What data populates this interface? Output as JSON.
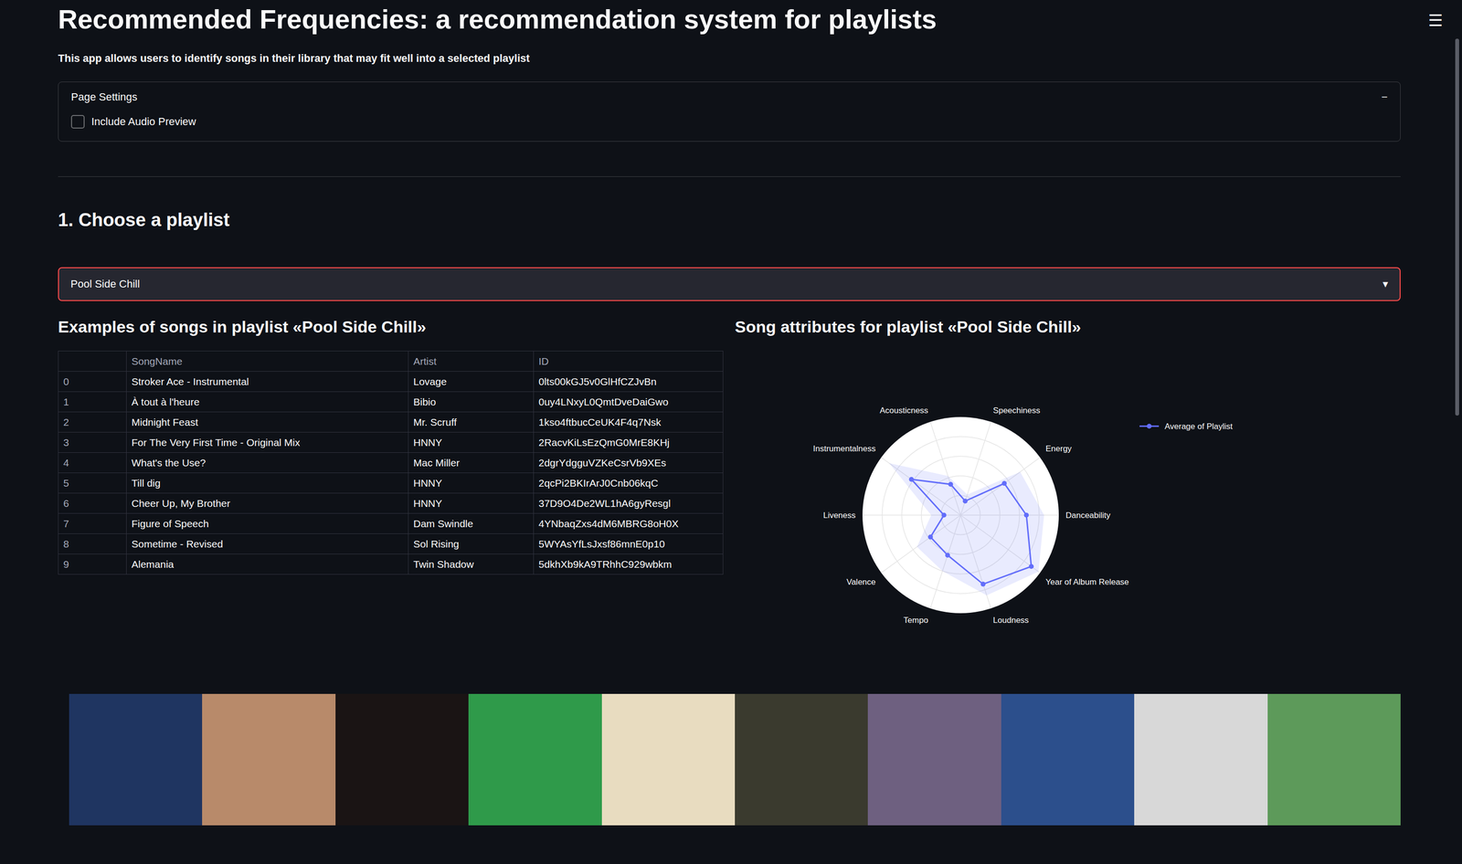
{
  "app": {
    "title": "Recommended Frequencies: a recommendation system for playlists",
    "subtitle": "This app allows users to identify songs in their library that may fit well into a selected playlist",
    "menu_icon": "☰"
  },
  "settings": {
    "label": "Page Settings",
    "toggle": "−",
    "expanded": true,
    "checkbox": {
      "label": "Include Audio Preview",
      "checked": false
    }
  },
  "playlist_section": {
    "heading": "1. Choose a playlist",
    "select": {
      "value": "Pool Side Chill",
      "arrow": "▾",
      "focused": true
    }
  },
  "table": {
    "heading": "Examples of songs in playlist «Pool Side Chill»",
    "columns": [
      "",
      "SongName",
      "Artist",
      "ID"
    ],
    "rows": [
      [
        "0",
        "Stroker Ace - Instrumental",
        "Lovage",
        "0lts00kGJ5v0GlHfCZJvBn"
      ],
      [
        "1",
        "À tout à l'heure",
        "Bibio",
        "0uy4LNxyL0QmtDveDaiGwo"
      ],
      [
        "2",
        "Midnight Feast",
        "Mr. Scruff",
        "1kso4ftbucCeUK4F4q7Nsk"
      ],
      [
        "3",
        "For The Very First Time - Original Mix",
        "HNNY",
        "2RacvKiLsEzQmG0MrE8KHj"
      ],
      [
        "4",
        "What's the Use?",
        "Mac Miller",
        "2dgrYdgguVZKeCsrVb9XEs"
      ],
      [
        "5",
        "Till dig",
        "HNNY",
        "2qcPi2BKIrArJ0Cnb06kqC"
      ],
      [
        "6",
        "Cheer Up, My Brother",
        "HNNY",
        "37D9O4De2WL1hA6gyResgl"
      ],
      [
        "7",
        "Figure of Speech",
        "Dam Swindle",
        "4YNbaqZxs4dM6MBRG8oH0X"
      ],
      [
        "8",
        "Sometime - Revised",
        "Sol Rising",
        "5WYAsYfLsJxsf86mnE0p10"
      ],
      [
        "9",
        "Alemania",
        "Twin Shadow",
        "5dkhXb9kA9TRhhC929wbkm"
      ]
    ]
  },
  "chart": {
    "title": "Song attributes for playlist «Pool Side Chill»",
    "axes": [
      "Acousticness",
      "Speechiness",
      "Energy",
      "Danceability",
      "Year of Album Release",
      "Loudness",
      "Tempo",
      "Valence",
      "Liveness",
      "Instrumentalness"
    ],
    "series": [
      {
        "name": "Average of Playlist",
        "color": "#636efa",
        "values": [
          0.33,
          0.15,
          0.55,
          0.67,
          0.89,
          0.74,
          0.43,
          0.38,
          0.17,
          0.62
        ]
      }
    ],
    "spread": [
      0.42,
      0.22,
      0.75,
      0.85,
      0.98,
      0.86,
      0.6,
      0.55,
      0.3,
      0.9
    ]
  },
  "album_covers": [
    {
      "color": "#1f3561"
    },
    {
      "color": "#b88a6a"
    },
    {
      "color": "#1a1414"
    },
    {
      "color": "#2f9a4a"
    },
    {
      "color": "#e8dcc0"
    },
    {
      "color": "#3a3a2e"
    },
    {
      "color": "#6e6080"
    },
    {
      "color": "#2c4f8c"
    },
    {
      "color": "#d8d8d8"
    },
    {
      "color": "#5d9a5a"
    }
  ]
}
